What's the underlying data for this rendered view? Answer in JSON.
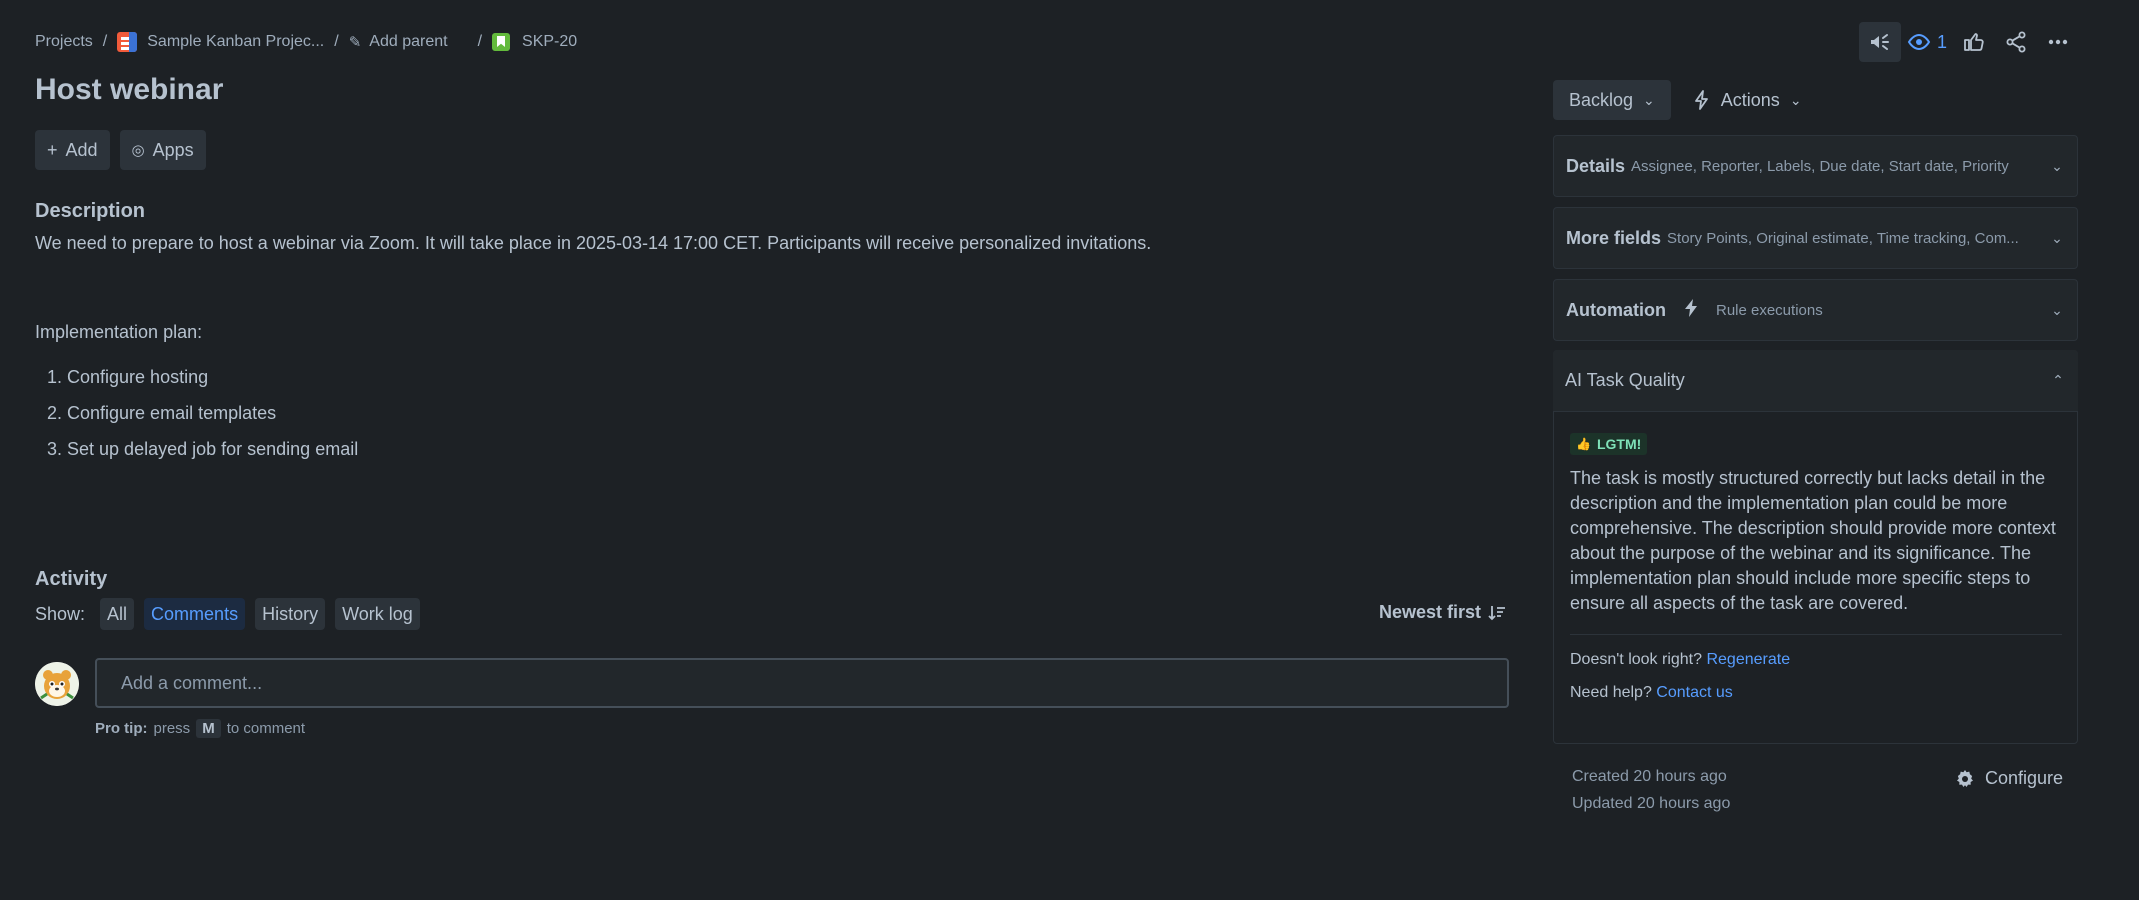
{
  "breadcrumb": {
    "projects": "Projects",
    "project_name": "Sample Kanban Projec...",
    "add_parent": "Add parent",
    "issue_key": "SKP-20"
  },
  "header_actions": {
    "watchers_count": "1"
  },
  "issue": {
    "title": "Host webinar",
    "add_label": "Add",
    "apps_label": "Apps"
  },
  "description": {
    "heading": "Description",
    "text": "We need to prepare to host a webinar via Zoom. It will take place in 2025-03-14 17:00 CET. Participants will receive personalized invitations.",
    "impl_heading": "Implementation plan:",
    "plan": [
      "1. Configure hosting",
      "2. Configure email templates",
      "3. Set up delayed job for sending email"
    ]
  },
  "activity": {
    "heading": "Activity",
    "show_label": "Show:",
    "filters": [
      "All",
      "Comments",
      "History",
      "Work log"
    ],
    "selected_filter": "Comments",
    "sort_label": "Newest first",
    "comment_placeholder": "Add a comment...",
    "protip_bold": "Pro tip:",
    "protip_press": "press",
    "protip_key": "M",
    "protip_rest": "to comment"
  },
  "sidebar": {
    "status_label": "Backlog",
    "actions_label": "Actions",
    "details": {
      "title": "Details",
      "summary": "Assignee, Reporter, Labels, Due date, Start date, Priority"
    },
    "more_fields": {
      "title": "More fields",
      "summary": "Story Points, Original estimate, Time tracking, Com..."
    },
    "automation": {
      "title": "Automation",
      "summary": "Rule executions"
    },
    "ai_quality": {
      "title": "AI Task Quality",
      "badge": "LGTM!",
      "text": "The task is mostly structured correctly but lacks detail in the description and the implementation plan could be more comprehensive. The description should provide more context about the purpose of the webinar and its significance. The implementation plan should include more specific steps to ensure all aspects of the task are covered.",
      "regen_prompt": "Doesn't look right?",
      "regen_link": "Regenerate",
      "help_prompt": "Need help?",
      "help_link": "Contact us"
    },
    "created": "Created 20 hours ago",
    "updated": "Updated 20 hours ago",
    "configure_label": "Configure"
  },
  "colors": {
    "background": "#1d2125",
    "accent": "#579dff",
    "lgtm_badge": "#1c3329"
  }
}
